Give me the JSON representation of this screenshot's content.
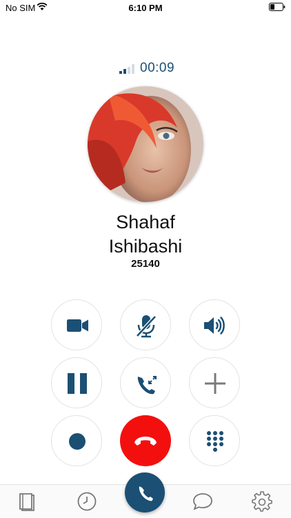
{
  "status_bar": {
    "carrier": "No SIM",
    "time": "6:10 PM"
  },
  "call": {
    "duration": "00:09",
    "signal_bars_active": 2,
    "contact_first_name": "Shahaf",
    "contact_last_name": "Ishibashi",
    "extension": "25140"
  },
  "controls": {
    "row1": [
      "video-camera-icon",
      "mute-microphone-icon",
      "speaker-icon"
    ],
    "row2": [
      "pause-icon",
      "transfer-call-icon",
      "plus-icon"
    ],
    "row3": [
      "record-icon",
      "hangup-icon",
      "keypad-icon"
    ]
  },
  "tabbar": {
    "items": [
      "contacts-book-icon",
      "recents-clock-icon",
      "phone-icon",
      "chat-bubble-icon",
      "settings-gear-icon"
    ]
  },
  "colors": {
    "accent": "#1b4f74",
    "hangup": "#f40f0f",
    "button_border": "#e2e2e2",
    "tab_icon": "#777777"
  }
}
